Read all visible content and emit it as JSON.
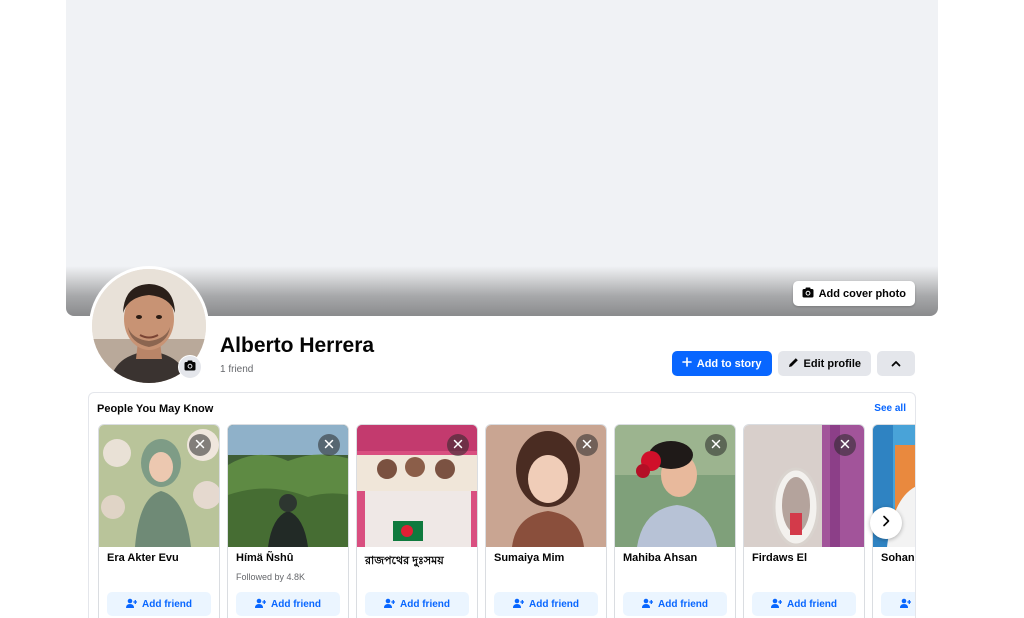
{
  "cover": {
    "add_cover_label": "Add cover photo"
  },
  "profile": {
    "name": "Alberto Herrera",
    "friends_count": "1 friend"
  },
  "actions": {
    "add_story_label": "Add to story",
    "edit_profile_label": "Edit profile"
  },
  "pymk": {
    "title": "People You May Know",
    "see_all": "See all",
    "add_friend_label": "Add friend",
    "people": [
      {
        "name": "Era Akter Evu",
        "subtitle": "",
        "img": "a"
      },
      {
        "name": "Hímä Ñshû",
        "subtitle": "Followed by 4.8K",
        "img": "b"
      },
      {
        "name": "রাজপথের দুঃসময়",
        "subtitle": "",
        "img": "c"
      },
      {
        "name": "Sumaiya Mim",
        "subtitle": "",
        "img": "d"
      },
      {
        "name": "Mahiba Ahsan",
        "subtitle": "",
        "img": "e"
      },
      {
        "name": "Firdaws El",
        "subtitle": "",
        "img": "f"
      },
      {
        "name": "Sohan I",
        "subtitle": "",
        "img": "g"
      }
    ]
  },
  "colors": {
    "accent": "#0866ff",
    "accent_light": "#ebf5ff",
    "secondary_bg": "#e4e6eb",
    "cover_bg": "#f0f2f5"
  }
}
